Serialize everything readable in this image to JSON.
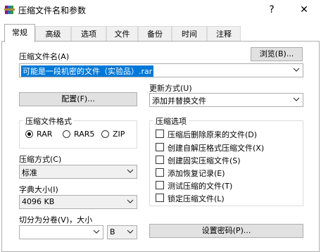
{
  "window": {
    "title": "压缩文件名和参数",
    "help_glyph": "?",
    "close_glyph": "✕",
    "icon": "winrar-books-icon"
  },
  "tabs": [
    {
      "label": "常规",
      "active": true
    },
    {
      "label": "高级",
      "active": false
    },
    {
      "label": "选项",
      "active": false
    },
    {
      "label": "文件",
      "active": false
    },
    {
      "label": "备份",
      "active": false
    },
    {
      "label": "时间",
      "active": false
    },
    {
      "label": "注释",
      "active": false
    }
  ],
  "archive_name": {
    "label": "压缩文件名(A)",
    "browse_button": "浏览(B)...",
    "value": "可能是一段机密的文件（实验品）.rar"
  },
  "profiles_button": "配置(F)...",
  "update_mode": {
    "label": "更新方式(U)",
    "value": "添加并替换文件"
  },
  "archive_format": {
    "label": "压缩文件格式",
    "options": [
      {
        "label": "RAR",
        "selected": true
      },
      {
        "label": "RAR5",
        "selected": false
      },
      {
        "label": "ZIP",
        "selected": false
      }
    ]
  },
  "compression_method": {
    "label": "压缩方式(C)",
    "value": "标准"
  },
  "dictionary_size": {
    "label": "字典大小(I)",
    "value": "4096 KB"
  },
  "split_volumes": {
    "label": "切分为分卷(V)，大小",
    "value": "",
    "unit": "B"
  },
  "archive_options": {
    "label": "压缩选项",
    "items": [
      {
        "label": "压缩后删除原来的文件(D)",
        "checked": false
      },
      {
        "label": "创建自解压格式压缩文件(X)",
        "checked": false
      },
      {
        "label": "创建固实压缩文件(S)",
        "checked": false
      },
      {
        "label": "添加恢复记录(E)",
        "checked": false
      },
      {
        "label": "测试压缩的文件(T)",
        "checked": false
      },
      {
        "label": "锁定压缩文件(L)",
        "checked": false
      }
    ]
  },
  "password_button": "设置密码(P)...",
  "colors": {
    "selection": "#0078d7",
    "button_face": "#e1e1e1",
    "border": "#adadad"
  }
}
